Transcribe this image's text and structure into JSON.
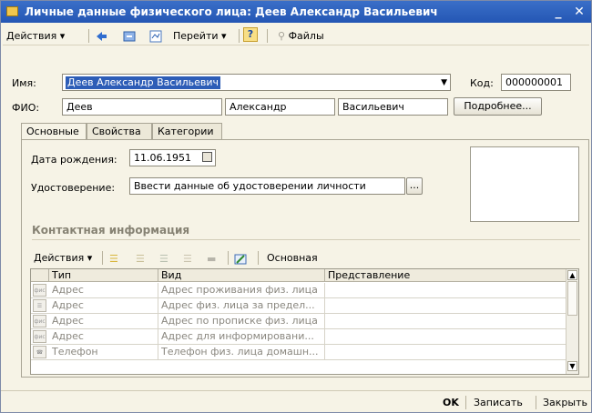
{
  "window": {
    "title": "Личные данные физического лица: Деев Александр Васильевич",
    "minimize": "_",
    "close": "✕"
  },
  "toolbar": {
    "actions": "Действия",
    "goto": "Перейти",
    "help": "?",
    "files": "Файлы"
  },
  "form": {
    "name_label": "Имя:",
    "name_value": "Деев Александр Васильевич",
    "code_label": "Код:",
    "code_value": "000000001",
    "fio_label": "ФИО:",
    "last_name": "Деев",
    "first_name": "Александр",
    "middle_name": "Васильевич",
    "details_button": "Подробнее..."
  },
  "tabs": [
    "Основные",
    "Свойства",
    "Категории"
  ],
  "main_tab": {
    "birthdate_label": "Дата рождения:",
    "birthdate_value": "11.06.1951",
    "id_label": "Удостоверение:",
    "id_value": "Ввести данные об удостоверении личности",
    "choose_button": "..."
  },
  "contacts": {
    "section_title": "Контактная информация",
    "actions": "Действия",
    "main_button": "Основная",
    "columns": [
      "Тип",
      "Вид",
      "Представление"
    ],
    "rows": [
      {
        "type": "Адрес",
        "kind": "Адрес проживания физ. лица",
        "repr": "",
        "icon": "фис"
      },
      {
        "type": "Адрес",
        "kind": "Адрес физ. лица за предел...",
        "repr": "",
        "icon": "☰"
      },
      {
        "type": "Адрес",
        "kind": "Адрес по прописке физ. лица",
        "repr": "",
        "icon": "фис"
      },
      {
        "type": "Адрес",
        "kind": "Адрес для информировани...",
        "repr": "",
        "icon": "фис"
      },
      {
        "type": "Телефон",
        "kind": "Телефон физ. лица домашн...",
        "repr": "",
        "icon": "☎"
      }
    ]
  },
  "footer": {
    "ok": "OK",
    "save": "Записать",
    "close": "Закрыть"
  }
}
